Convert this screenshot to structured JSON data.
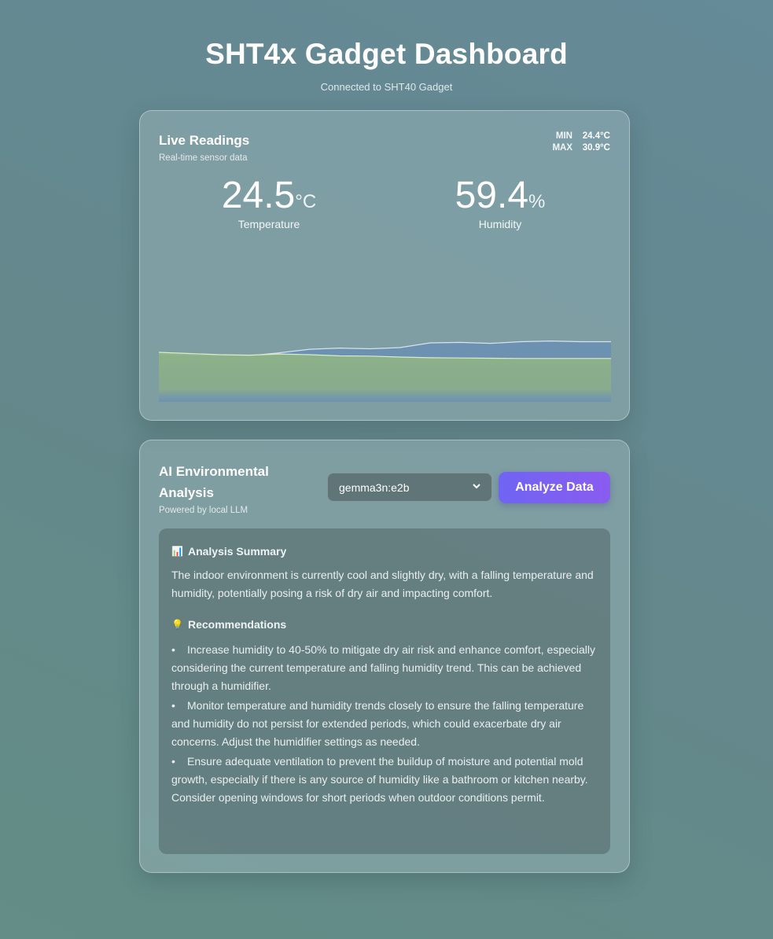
{
  "header": {
    "title": "SHT4x Gadget Dashboard",
    "subtitle": "Connected to SHT40 Gadget"
  },
  "live": {
    "title": "Live Readings",
    "subtitle": "Real-time sensor data",
    "min_label": "MIN",
    "min_value": "24.4°C",
    "max_label": "MAX",
    "max_value": "30.9°C",
    "temperature": {
      "value": "24.5",
      "unit": "°C",
      "label": "Temperature"
    },
    "humidity": {
      "value": "59.4",
      "unit": "%",
      "label": "Humidity"
    }
  },
  "chart_data": {
    "type": "area",
    "series": [
      {
        "values": [
          40.2,
          40.0,
          39.8,
          39.5,
          40.8,
          42.3,
          42.8,
          42.5,
          43.0,
          45.0,
          45.2,
          44.8,
          45.5,
          45.8,
          45.5,
          45.5
        ]
      },
      {
        "values": [
          41.0,
          40.5,
          40.0,
          39.8,
          40.3,
          40.0,
          39.5,
          39.4,
          39.0,
          38.7,
          38.6,
          38.5,
          38.4,
          38.4,
          38.4,
          38.4
        ]
      }
    ],
    "colors": [
      "#6c90b2",
      "#8fb387"
    ],
    "ylim": [
      0,
      100
    ]
  },
  "ai": {
    "title": "AI Environmental Analysis",
    "subtitle": "Powered by local LLM",
    "model_selected": "gemma3n:e2b",
    "analyze_label": "Analyze Data",
    "summary_icon": "📊",
    "summary_title": "Analysis Summary",
    "summary_text": "The indoor environment is currently cool and slightly dry, with a falling temperature and humidity, potentially posing a risk of dry air and impacting comfort.",
    "rec_icon": "💡",
    "rec_title": "Recommendations",
    "recommendations": [
      "Increase humidity to 40-50% to mitigate dry air risk and enhance comfort, especially considering the current temperature and falling humidity trend. This can be achieved through a humidifier.",
      "Monitor temperature and humidity trends closely to ensure the falling temperature and humidity do not persist for extended periods, which could exacerbate dry air concerns. Adjust the humidifier settings as needed.",
      "Ensure adequate ventilation to prevent the buildup of moisture and potential mold growth, especially if there is any source of humidity like a bathroom or kitchen nearby. Consider opening windows for short periods when outdoor conditions permit."
    ]
  },
  "icons": {
    "select_chevron": "chevron-down-icon"
  }
}
